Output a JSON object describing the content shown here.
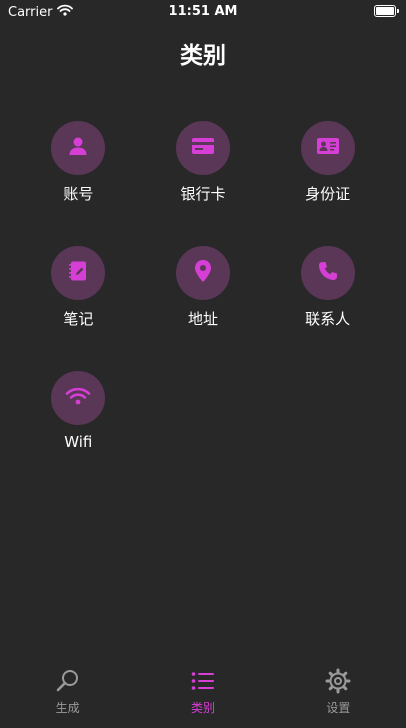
{
  "status_bar": {
    "carrier": "Carrier",
    "time": "11:51 AM",
    "battery_level": 1.0
  },
  "header": {
    "title": "类别"
  },
  "categories": [
    {
      "label": "账号",
      "icon": "person-icon"
    },
    {
      "label": "银行卡",
      "icon": "credit-card-icon"
    },
    {
      "label": "身份证",
      "icon": "id-card-icon"
    },
    {
      "label": "笔记",
      "icon": "notebook-icon"
    },
    {
      "label": "地址",
      "icon": "location-pin-icon"
    },
    {
      "label": "联系人",
      "icon": "phone-icon"
    },
    {
      "label": "Wifi",
      "icon": "wifi-icon"
    }
  ],
  "tabs": [
    {
      "label": "生成",
      "icon": "magnifier-icon",
      "active": false
    },
    {
      "label": "类别",
      "icon": "list-icon",
      "active": true
    },
    {
      "label": "设置",
      "icon": "gear-icon",
      "active": false
    }
  ],
  "colors": {
    "background": "#282828",
    "accent": "#d63fd6",
    "icon_circle": "#5a3757",
    "tab_inactive": "#9a9a9a"
  }
}
